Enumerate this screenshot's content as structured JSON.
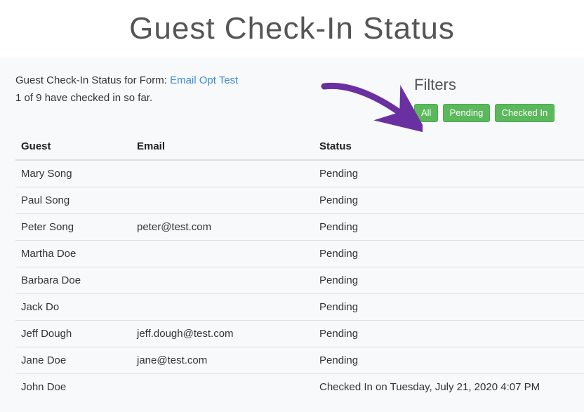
{
  "page_title": "Guest Check-In Status",
  "intro_prefix": "Guest Check-In Status for Form: ",
  "form_link_text": "Email Opt Test",
  "count_line": "1 of 9 have checked in so far.",
  "filters_heading": "Filters",
  "filter_buttons": [
    "All",
    "Pending",
    "Checked In"
  ],
  "columns": {
    "guest": "Guest",
    "email": "Email",
    "status": "Status"
  },
  "rows": [
    {
      "guest": "Mary Song",
      "email": "",
      "status": "Pending"
    },
    {
      "guest": "Paul Song",
      "email": "",
      "status": "Pending"
    },
    {
      "guest": "Peter Song",
      "email": "peter@test.com",
      "status": "Pending"
    },
    {
      "guest": "Martha Doe",
      "email": "",
      "status": "Pending"
    },
    {
      "guest": "Barbara Doe",
      "email": "",
      "status": "Pending"
    },
    {
      "guest": "Jack Do",
      "email": "",
      "status": "Pending"
    },
    {
      "guest": "Jeff Dough",
      "email": "jeff.dough@test.com",
      "status": "Pending"
    },
    {
      "guest": "Jane Doe",
      "email": "jane@test.com",
      "status": "Pending"
    },
    {
      "guest": "John Doe",
      "email": "",
      "status": "Checked In on Tuesday, July 21, 2020 4:07 PM"
    }
  ],
  "accent_color": "#5cb85c",
  "arrow_color": "#6a2fa0"
}
